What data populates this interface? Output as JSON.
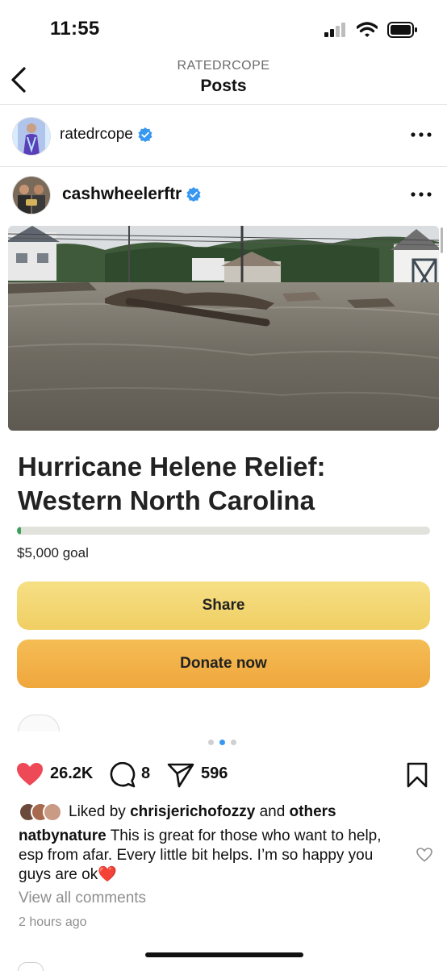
{
  "status_bar": {
    "time": "11:55",
    "icons": [
      "cellular-signal-icon",
      "wifi-icon",
      "battery-icon"
    ]
  },
  "header": {
    "subtitle": "RATEDRCOPE",
    "title": "Posts",
    "back_icon": "chevron-left-icon"
  },
  "profile_row": {
    "username": "ratedrcope",
    "verified": true,
    "more_icon": "more-dots-icon"
  },
  "post": {
    "author": "cashwheelerftr",
    "verified": true,
    "more_icon": "more-dots-icon",
    "embedded": {
      "title": "Hurricane Helene Relief: Western North Carolina",
      "progress_fraction": 0.01,
      "goal_text": "$5,000 goal",
      "share_label": "Share",
      "donate_label": "Donate now",
      "colors": {
        "share": "#f3d774",
        "donate": "#f2b249",
        "progress": "#3aa05a"
      }
    },
    "carousel": {
      "count": 3,
      "active_index": 1
    },
    "actions": {
      "likes": "26.2K",
      "comments": "8",
      "shares": "596",
      "like_color": "#ed4956"
    },
    "liked_by": {
      "prefix": "Liked by",
      "user": "chrisjerichofozzy",
      "connector": "and",
      "others": "others"
    },
    "caption": {
      "user": "natbynature",
      "text": "This is great for those who want to help, esp from afar. Every little bit helps. I’m so happy you guys are ok❤️"
    },
    "view_comments": "View all comments",
    "time_ago": "2 hours ago"
  }
}
